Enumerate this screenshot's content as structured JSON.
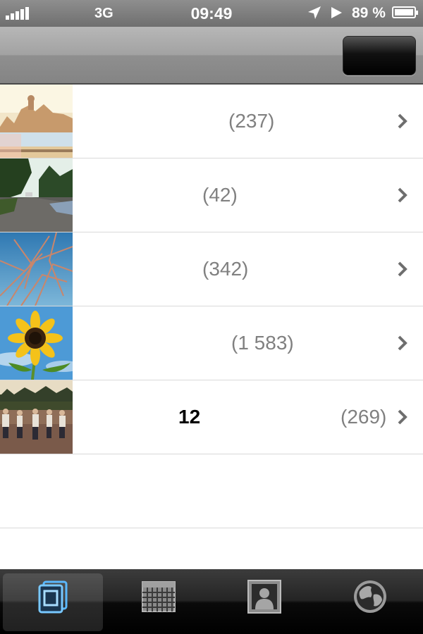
{
  "status_bar": {
    "signal_bars": 5,
    "carrier": "3G",
    "time": "09:49",
    "battery_percent": "89 %",
    "battery_level": 0.89,
    "icons": [
      "signal-icon",
      "location-icon",
      "play-icon",
      "battery-icon"
    ]
  },
  "nav_bar": {
    "right_button_label": ""
  },
  "albums": [
    {
      "title": "",
      "count": "(237)",
      "thumbnail": "city-waterfront-photo"
    },
    {
      "title": "",
      "count": "(42)",
      "thumbnail": "road-trees-photo"
    },
    {
      "title": "",
      "count": "(342)",
      "thumbnail": "branches-sky-photo"
    },
    {
      "title": "",
      "count": "(1 583)",
      "thumbnail": "sunflower-photo"
    },
    {
      "title": "12",
      "count": "(269)",
      "thumbnail": "people-field-photo"
    }
  ],
  "tab_bar": {
    "tabs": [
      {
        "name": "albums",
        "icon": "photo-stack-icon",
        "active": true
      },
      {
        "name": "events",
        "icon": "calendar-grid-icon",
        "active": false
      },
      {
        "name": "faces",
        "icon": "person-icon",
        "active": false
      },
      {
        "name": "places",
        "icon": "globe-icon",
        "active": false
      }
    ]
  },
  "colors": {
    "accent_blue": "#4fb3ff",
    "count_gray": "#808080",
    "separator": "#d9d9d9"
  }
}
